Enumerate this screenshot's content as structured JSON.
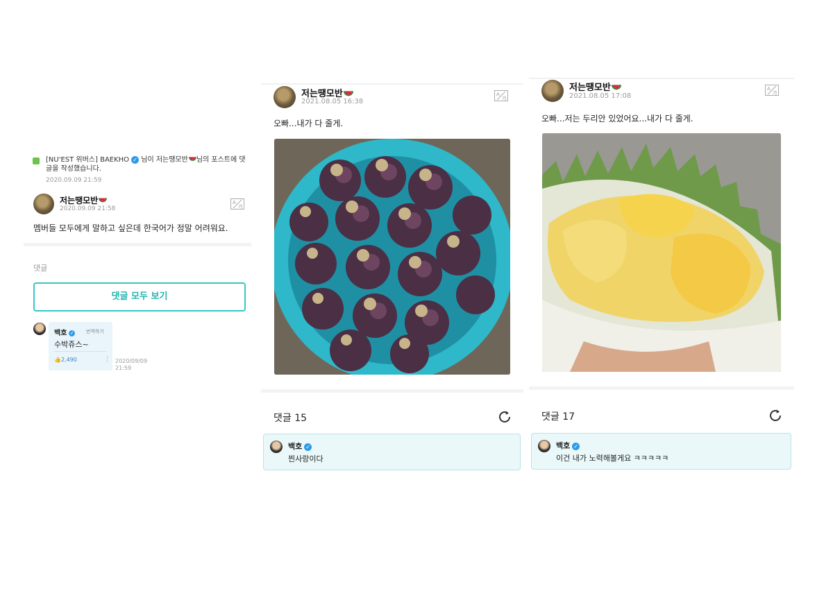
{
  "panel1": {
    "notification": {
      "source": "[NU'EST 위버스] BAEKHO",
      "suffix_part1": " 님이 저는땡모반",
      "suffix_part2": "님의 포스트에 댓글을 작성했습니다.",
      "time": "2020.09.09 21:59"
    },
    "post": {
      "author": "저는땡모반",
      "date": "2020.09.09 21:58",
      "text": "멤버들 모두에게 말하고 싶은데 한국어가 정말 어려워요."
    },
    "comments_label": "댓글",
    "view_all_label": "댓글 모두 보기",
    "comment": {
      "author": "백호",
      "translate_label": "번역하기",
      "text": "수박쥬스~",
      "likes": "2,490",
      "date_line1": "2020/09/09",
      "date_line2": "21:59"
    }
  },
  "panel2": {
    "post": {
      "author": "저는땡모반",
      "date": "2021.08.05 16:38",
      "text": "오빠...내가 다 줄게."
    },
    "comments_label": "댓글 15",
    "comment": {
      "author": "백호",
      "text": "찐사랑이다"
    }
  },
  "panel3": {
    "post": {
      "author": "저는땡모반",
      "date": "2021.08.05 17:08",
      "text": "오빠...저는 두리안 있었어요...내가 다 줄게."
    },
    "comments_label": "댓글 17",
    "comment": {
      "author": "백호",
      "text": "이건 내가 노력해볼게요 ㅋㅋㅋㅋㅋ"
    }
  },
  "icons": {
    "translate": "translate-icon",
    "refresh": "refresh-icon",
    "verified": "verified-check-icon",
    "watermelon": "watermelon-emoji-icon",
    "like": "thumbs-up-icon"
  },
  "colors": {
    "accent": "#1fb5ae",
    "verified": "#2f9be8",
    "comment_bg": "#eaf8fa",
    "notification_icon": "#6cc24a"
  }
}
